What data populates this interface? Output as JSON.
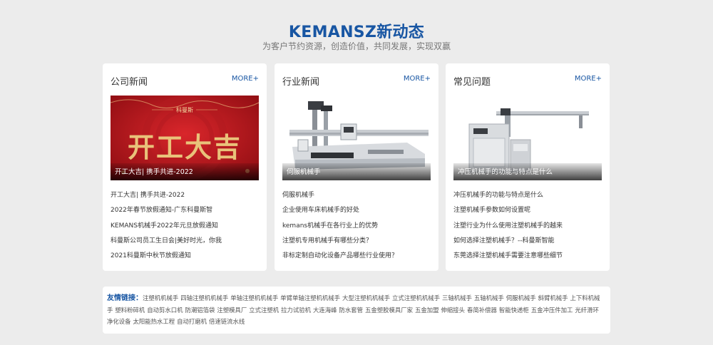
{
  "header": {
    "title": "KEMANSZ新动态",
    "subtitle": "为客户节约资源，创造价值，共同发展，实现双赢"
  },
  "cards": [
    {
      "title": "公司新闻",
      "more": "MORE+",
      "image_caption": "开工大吉| 携手共进-2022",
      "image_banner_text": "开工大吉",
      "image_banner_brand": "科曼斯",
      "items": [
        "开工大吉| 携手共进-2022",
        "2022年春节放假通知-广东科曼斯智",
        "KEMANS机械手2022年元旦放假通知",
        "科曼斯公司员工生日会|美好时光，你我",
        "2021科曼斯中秋节放假通知"
      ]
    },
    {
      "title": "行业新闻",
      "more": "MORE+",
      "image_caption": "伺服机械手",
      "items": [
        "伺服机械手",
        "企业使用车床机械手的好处",
        "kemans机械手在各行业上的优势",
        "注塑机专用机械手有哪些分类？",
        "非标定制自动化设备产品哪些行业使用？"
      ]
    },
    {
      "title": "常见问题",
      "more": "MORE+",
      "image_caption": "冲压机械手的功能与特点是什么",
      "items": [
        "冲压机械手的功能与特点是什么",
        "注塑机械手参数如何设置呢",
        "注塑行业为什么使用注塑机械手的越来",
        "如何选择注塑机械手？--科曼斯智能",
        "东莞选择注塑机械手需要注意哪些细节"
      ]
    }
  ],
  "links": {
    "label": "友情链接：",
    "items": [
      "注塑机机械手",
      "四轴注塑机机械手",
      "单轴注塑机机械手",
      "单臂单轴注塑机机械手",
      "大型注塑机机械手",
      "立式注塑机机械手",
      "三轴机械手",
      "五轴机械手",
      "伺服机械手",
      "斜臂机械手",
      "上下料机械手",
      "塑料粉碎机",
      "自动剪水口机",
      "防潮铝箔袋",
      "注塑模具厂",
      "立式注塑机",
      "拉力试验机",
      "大连海峰",
      "防水套管",
      "五金塑胶模具厂家",
      "五金加盟",
      "伸缩接头",
      "春简补偿器",
      "智能快递柜",
      "五金冲压件加工",
      "光纤滑环",
      "净化设备",
      "太阳能热水工程",
      "自动打磨机",
      "倍速链流水线"
    ]
  },
  "colors": {
    "accent": "#1856a3",
    "banner_red": "#c21a1f",
    "banner_gold": "#e9c27a",
    "page_bg": "#ececec"
  }
}
